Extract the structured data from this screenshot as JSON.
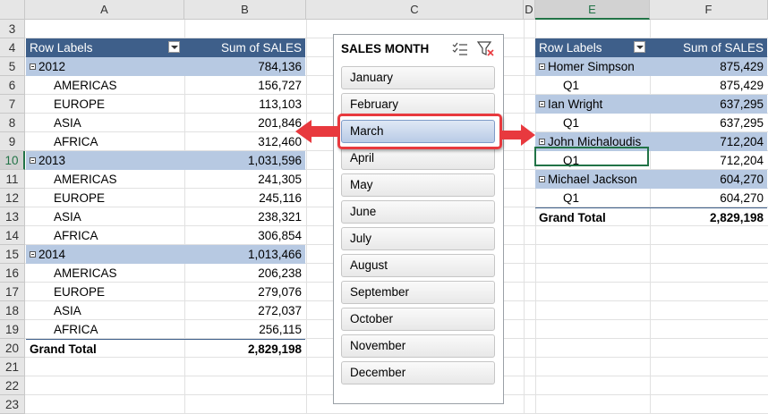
{
  "columns": [
    "A",
    "B",
    "C",
    "D",
    "E",
    "F"
  ],
  "rows": [
    "3",
    "4",
    "5",
    "6",
    "7",
    "8",
    "9",
    "10",
    "11",
    "12",
    "13",
    "14",
    "15",
    "16",
    "17",
    "18",
    "19",
    "20",
    "21",
    "22",
    "23"
  ],
  "pivot_left": {
    "header_label": "Row Labels",
    "header_value": "Sum of SALES",
    "groups": [
      {
        "label": "2012",
        "value": "784,136",
        "items": [
          {
            "label": "AMERICAS",
            "value": "156,727"
          },
          {
            "label": "EUROPE",
            "value": "113,103"
          },
          {
            "label": "ASIA",
            "value": "201,846"
          },
          {
            "label": "AFRICA",
            "value": "312,460"
          }
        ]
      },
      {
        "label": "2013",
        "value": "1,031,596",
        "items": [
          {
            "label": "AMERICAS",
            "value": "241,305"
          },
          {
            "label": "EUROPE",
            "value": "245,116"
          },
          {
            "label": "ASIA",
            "value": "238,321"
          },
          {
            "label": "AFRICA",
            "value": "306,854"
          }
        ]
      },
      {
        "label": "2014",
        "value": "1,013,466",
        "items": [
          {
            "label": "AMERICAS",
            "value": "206,238"
          },
          {
            "label": "EUROPE",
            "value": "279,076"
          },
          {
            "label": "ASIA",
            "value": "272,037"
          },
          {
            "label": "AFRICA",
            "value": "256,115"
          }
        ]
      }
    ],
    "total_label": "Grand Total",
    "total_value": "2,829,198"
  },
  "slicer": {
    "title": "SALES MONTH",
    "items": [
      "January",
      "February",
      "March",
      "April",
      "May",
      "June",
      "July",
      "August",
      "September",
      "October",
      "November",
      "December"
    ],
    "selected": "March"
  },
  "pivot_right": {
    "header_label": "Row Labels",
    "header_value": "Sum of SALES",
    "groups": [
      {
        "label": "Homer Simpson",
        "value": "875,429",
        "items": [
          {
            "label": "Q1",
            "value": "875,429"
          }
        ]
      },
      {
        "label": "Ian Wright",
        "value": "637,295",
        "items": [
          {
            "label": "Q1",
            "value": "637,295"
          }
        ]
      },
      {
        "label": "John Michaloudis",
        "value": "712,204",
        "items": [
          {
            "label": "Q1",
            "value": "712,204"
          }
        ]
      },
      {
        "label": "Michael Jackson",
        "value": "604,270",
        "items": [
          {
            "label": "Q1",
            "value": "604,270"
          }
        ]
      }
    ],
    "total_label": "Grand Total",
    "total_value": "2,829,198"
  },
  "colors": {
    "pivot_header": "#3e5f8a",
    "pivot_group": "#b7c9e2",
    "highlight": "#e8393e",
    "selection": "#217346"
  }
}
